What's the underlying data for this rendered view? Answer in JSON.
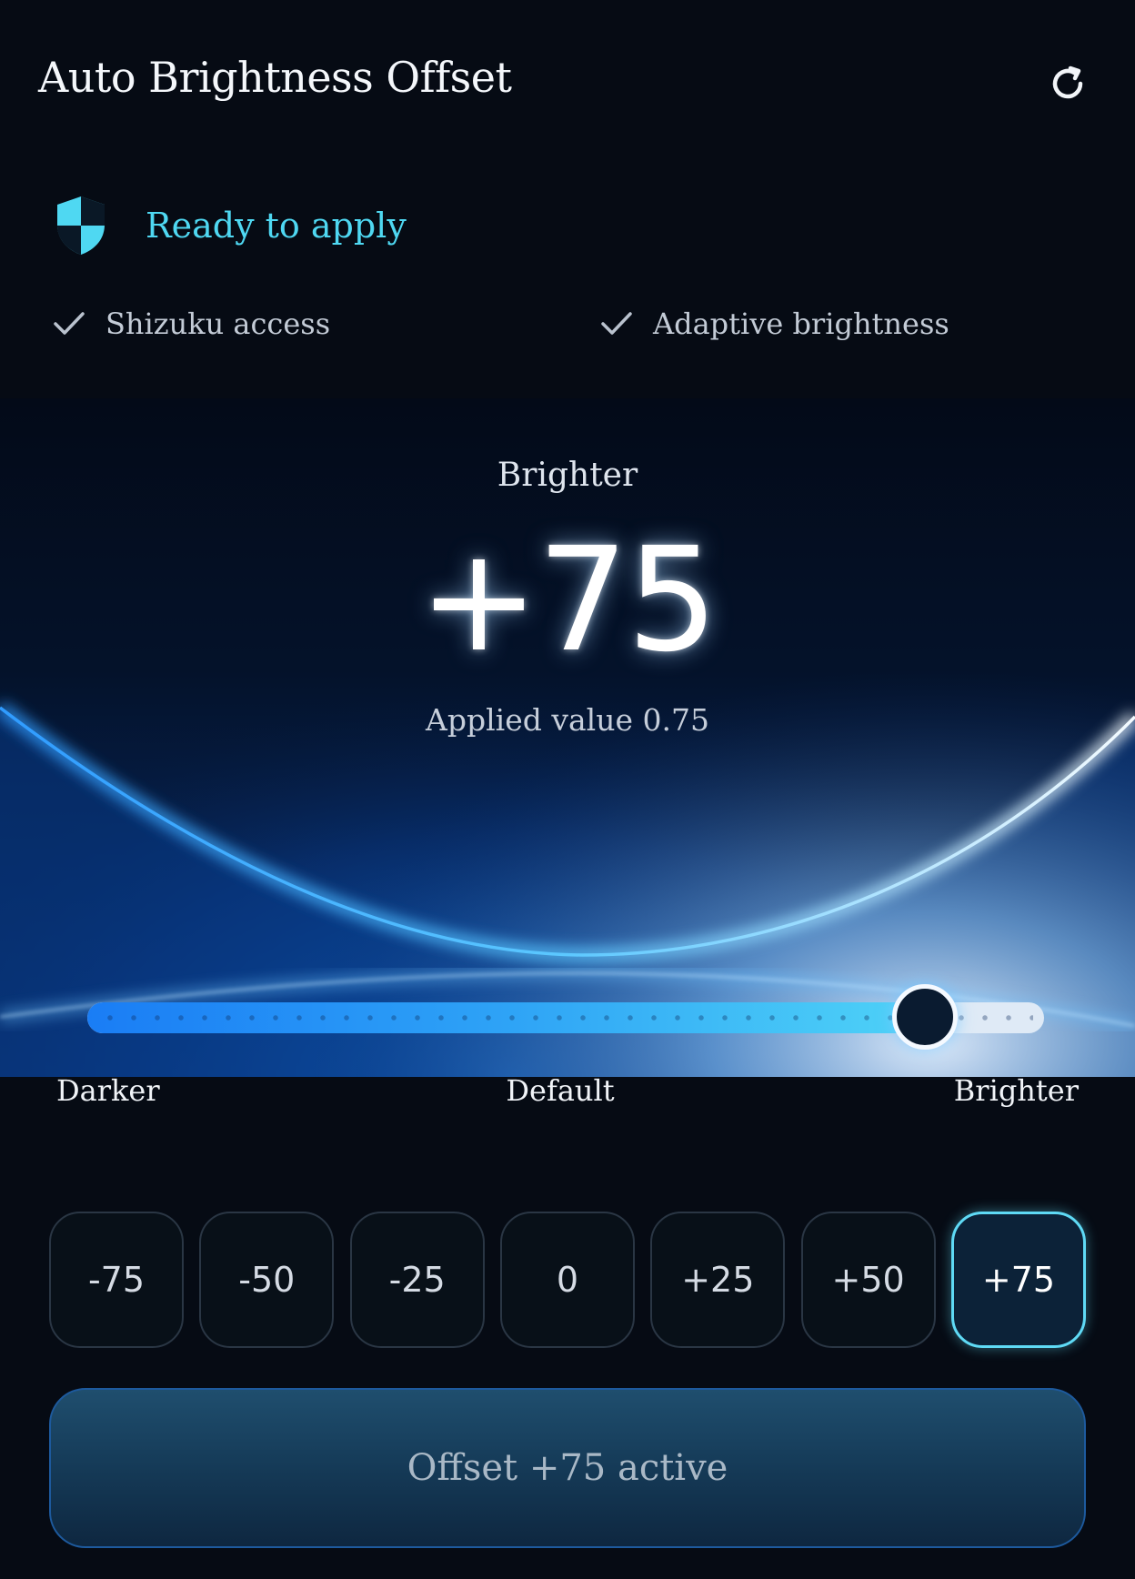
{
  "header": {
    "title": "Auto Brightness Offset",
    "refresh_icon": "refresh-icon"
  },
  "status": {
    "text": "Ready to apply",
    "icon": "shield-icon",
    "accent_color": "#4fd8f2",
    "checks": [
      {
        "label": "Shizuku access",
        "icon": "check-icon"
      },
      {
        "label": "Adaptive brightness",
        "icon": "check-icon"
      }
    ]
  },
  "hero": {
    "mode_label": "Brighter",
    "value_display": "+75",
    "applied_text": "Applied value 0.75"
  },
  "slider": {
    "min": -100,
    "max": 100,
    "value": 75,
    "labels": {
      "left": "Darker",
      "center": "Default",
      "right": "Brighter"
    }
  },
  "presets": [
    {
      "label": "-75",
      "active": false
    },
    {
      "label": "-50",
      "active": false
    },
    {
      "label": "-25",
      "active": false
    },
    {
      "label": "0",
      "active": false
    },
    {
      "label": "+25",
      "active": false
    },
    {
      "label": "+50",
      "active": false
    },
    {
      "label": "+75",
      "active": true
    }
  ],
  "apply_button": {
    "label": "Offset +75 active"
  }
}
